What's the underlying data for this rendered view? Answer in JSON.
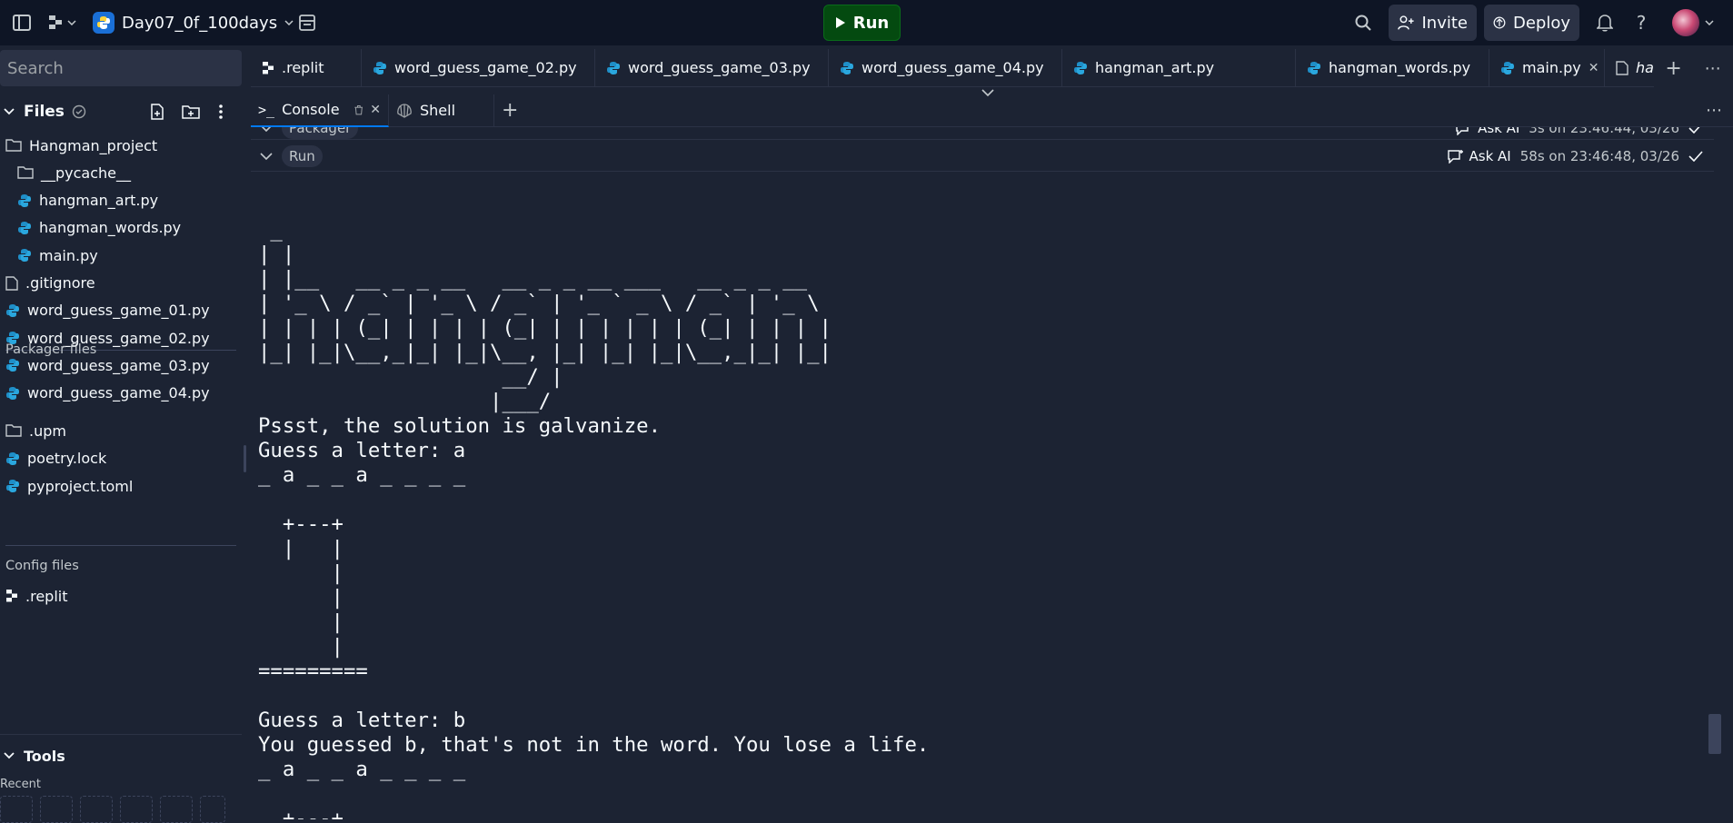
{
  "topbar": {
    "repl_name": "Day07_0f_100days",
    "run_label": "Run",
    "invite_label": "Invite",
    "deploy_label": "Deploy"
  },
  "sidebar": {
    "search_placeholder": "Search",
    "files_title": "Files",
    "tree": [
      {
        "label": "Hangman_project",
        "type": "folder"
      },
      {
        "label": "__pycache__",
        "type": "folder"
      },
      {
        "label": "hangman_art.py",
        "type": "python"
      },
      {
        "label": "hangman_words.py",
        "type": "python"
      },
      {
        "label": "main.py",
        "type": "python"
      },
      {
        "label": ".gitignore",
        "type": "file"
      },
      {
        "label": "word_guess_game_01.py",
        "type": "python"
      },
      {
        "label": "word_guess_game_02.py",
        "type": "python"
      },
      {
        "label": "word_guess_game_03.py",
        "type": "python"
      },
      {
        "label": "word_guess_game_04.py",
        "type": "python"
      }
    ],
    "packager_title": "Packager files",
    "packager": [
      {
        "label": ".upm",
        "type": "folder"
      },
      {
        "label": "poetry.lock",
        "type": "python"
      },
      {
        "label": "pyproject.toml",
        "type": "python"
      }
    ],
    "config_title": "Config files",
    "config": [
      {
        "label": ".replit",
        "type": "replit"
      }
    ],
    "tools_title": "Tools",
    "recent_label": "Recent"
  },
  "tabs": [
    {
      "label": ".replit",
      "type": "replit"
    },
    {
      "label": "word_guess_game_02.py",
      "type": "python"
    },
    {
      "label": "word_guess_game_03.py",
      "type": "python"
    },
    {
      "label": "word_guess_game_04.py",
      "type": "python"
    },
    {
      "label": "hangman_art.py",
      "type": "python"
    },
    {
      "label": "hangman_words.py",
      "type": "python"
    },
    {
      "label": "main.py",
      "type": "python",
      "active": true
    },
    {
      "label": "hangman_ar",
      "type": "file",
      "italic": true
    }
  ],
  "pane": {
    "console_label": "Console",
    "shell_label": "Shell"
  },
  "console": {
    "packager": {
      "chip": "Packager",
      "ask_ai": "Ask AI",
      "time": "3s on 23:46:44, 03/26"
    },
    "run": {
      "chip": "Run",
      "ask_ai": "Ask AI",
      "time": "58s on 23:46:48, 03/26"
    },
    "output": " _\n| |\n| |__   __ _ _ __   __ _ _ __ ___   __ _ _ __\n| '_ \\ / _` | '_ \\ / _` | '_ ` _ \\ / _` | '_ \\\n| | | | (_| | | | | (_| | | | | | | (_| | | | |\n|_| |_|\\__,_|_| |_|\\__, |_| |_| |_|\\__,_|_| |_|\n                    __/ |\n                   |___/\nPssst, the solution is galvanize.\nGuess a letter: a\n_ a _ _ a _ _ _ _\n\n  +---+\n  |   |\n      |\n      |\n      |\n      |\n=========\n\nGuess a letter: b\nYou guessed b, that's not in the word. You lose a life.\n_ a _ _ a _ _ _ _\n\n  +---+"
  },
  "colors": {
    "background": "#1c2333",
    "topbar": "#0e1525",
    "run_green": "#044a10",
    "accent_blue": "#0079f2",
    "python_icon": "#1f8fc8"
  }
}
